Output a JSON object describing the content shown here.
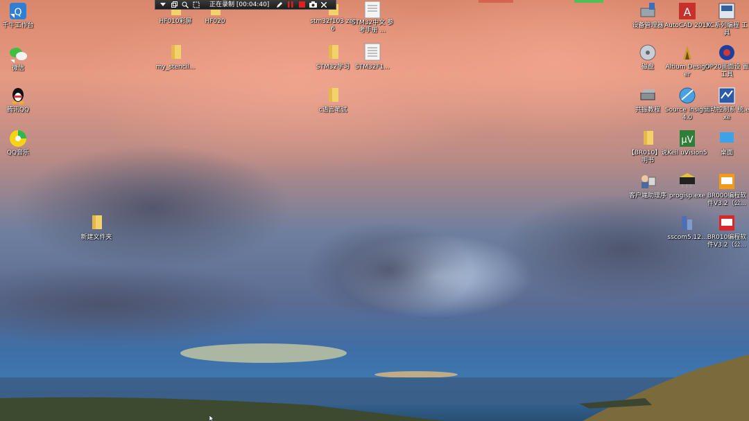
{
  "toolbar": {
    "status_text": "正在录制 [00:04:40]",
    "icons": [
      "dropdown-icon",
      "restore-icon",
      "zoom-icon",
      "region-icon",
      "pen-icon",
      "pause-icon",
      "stop-icon",
      "camera-icon",
      "close-icon"
    ]
  },
  "colors": {
    "toolbar_bg": "#262626",
    "record_red": "#e02020",
    "folder_yellow": "#f3d26a",
    "accent_green": "#4fbf5a"
  },
  "icons_left": [
    {
      "id": "xinzhong",
      "label": "千牛工作台"
    },
    {
      "id": "wechat",
      "label": "微信"
    },
    {
      "id": "qq",
      "label": "腾讯QQ"
    },
    {
      "id": "qqmusic",
      "label": "QQ音乐"
    },
    {
      "id": "newfolder",
      "label": "新建文件夹"
    }
  ],
  "icons_mid": [
    {
      "id": "hf010",
      "label": "HF010彩屏"
    },
    {
      "id": "hf020",
      "label": "HF020"
    },
    {
      "id": "stencil",
      "label": "my_stencil..."
    },
    {
      "id": "stm32f103",
      "label": "stm32f103 zet6"
    },
    {
      "id": "stm32cn",
      "label": "STM32中文 参考手册 ..."
    },
    {
      "id": "stm32study",
      "label": "STM32学习"
    },
    {
      "id": "stm32f1",
      "label": "STM32F1..."
    },
    {
      "id": "cbase",
      "label": "c语言笔试"
    }
  ],
  "icons_right": [
    {
      "id": "devmgr",
      "label": "设备管理器"
    },
    {
      "id": "autocad",
      "label": "AutoCAD 2019"
    },
    {
      "id": "xcprog",
      "label": "XC系列编程 工具"
    },
    {
      "id": "cdisk",
      "label": "磁盘"
    },
    {
      "id": "altium",
      "label": "Altium Designer"
    },
    {
      "id": "op20",
      "label": "OP20画面设 置工具"
    },
    {
      "id": "zhuanjie",
      "label": "共振教程"
    },
    {
      "id": "sourceinsight",
      "label": "Source Insight 4.0"
    },
    {
      "id": "motion",
      "label": "运动控制系 统.exe"
    },
    {
      "id": "br010doc",
      "label": "【BR010】说 明书"
    },
    {
      "id": "keil",
      "label": "Keil uVision5"
    },
    {
      "id": "desktop",
      "label": "桌面"
    },
    {
      "id": "customer",
      "label": "客户端助理序"
    },
    {
      "id": "progisp",
      "label": "progisp.exe"
    },
    {
      "id": "br000",
      "label": "BR000编程软 件V3.2（公..."
    },
    {
      "id": "sscom",
      "label": "sscom5.12..."
    },
    {
      "id": "br010prog",
      "label": "BR010编程软 件V3.2（公..."
    }
  ]
}
